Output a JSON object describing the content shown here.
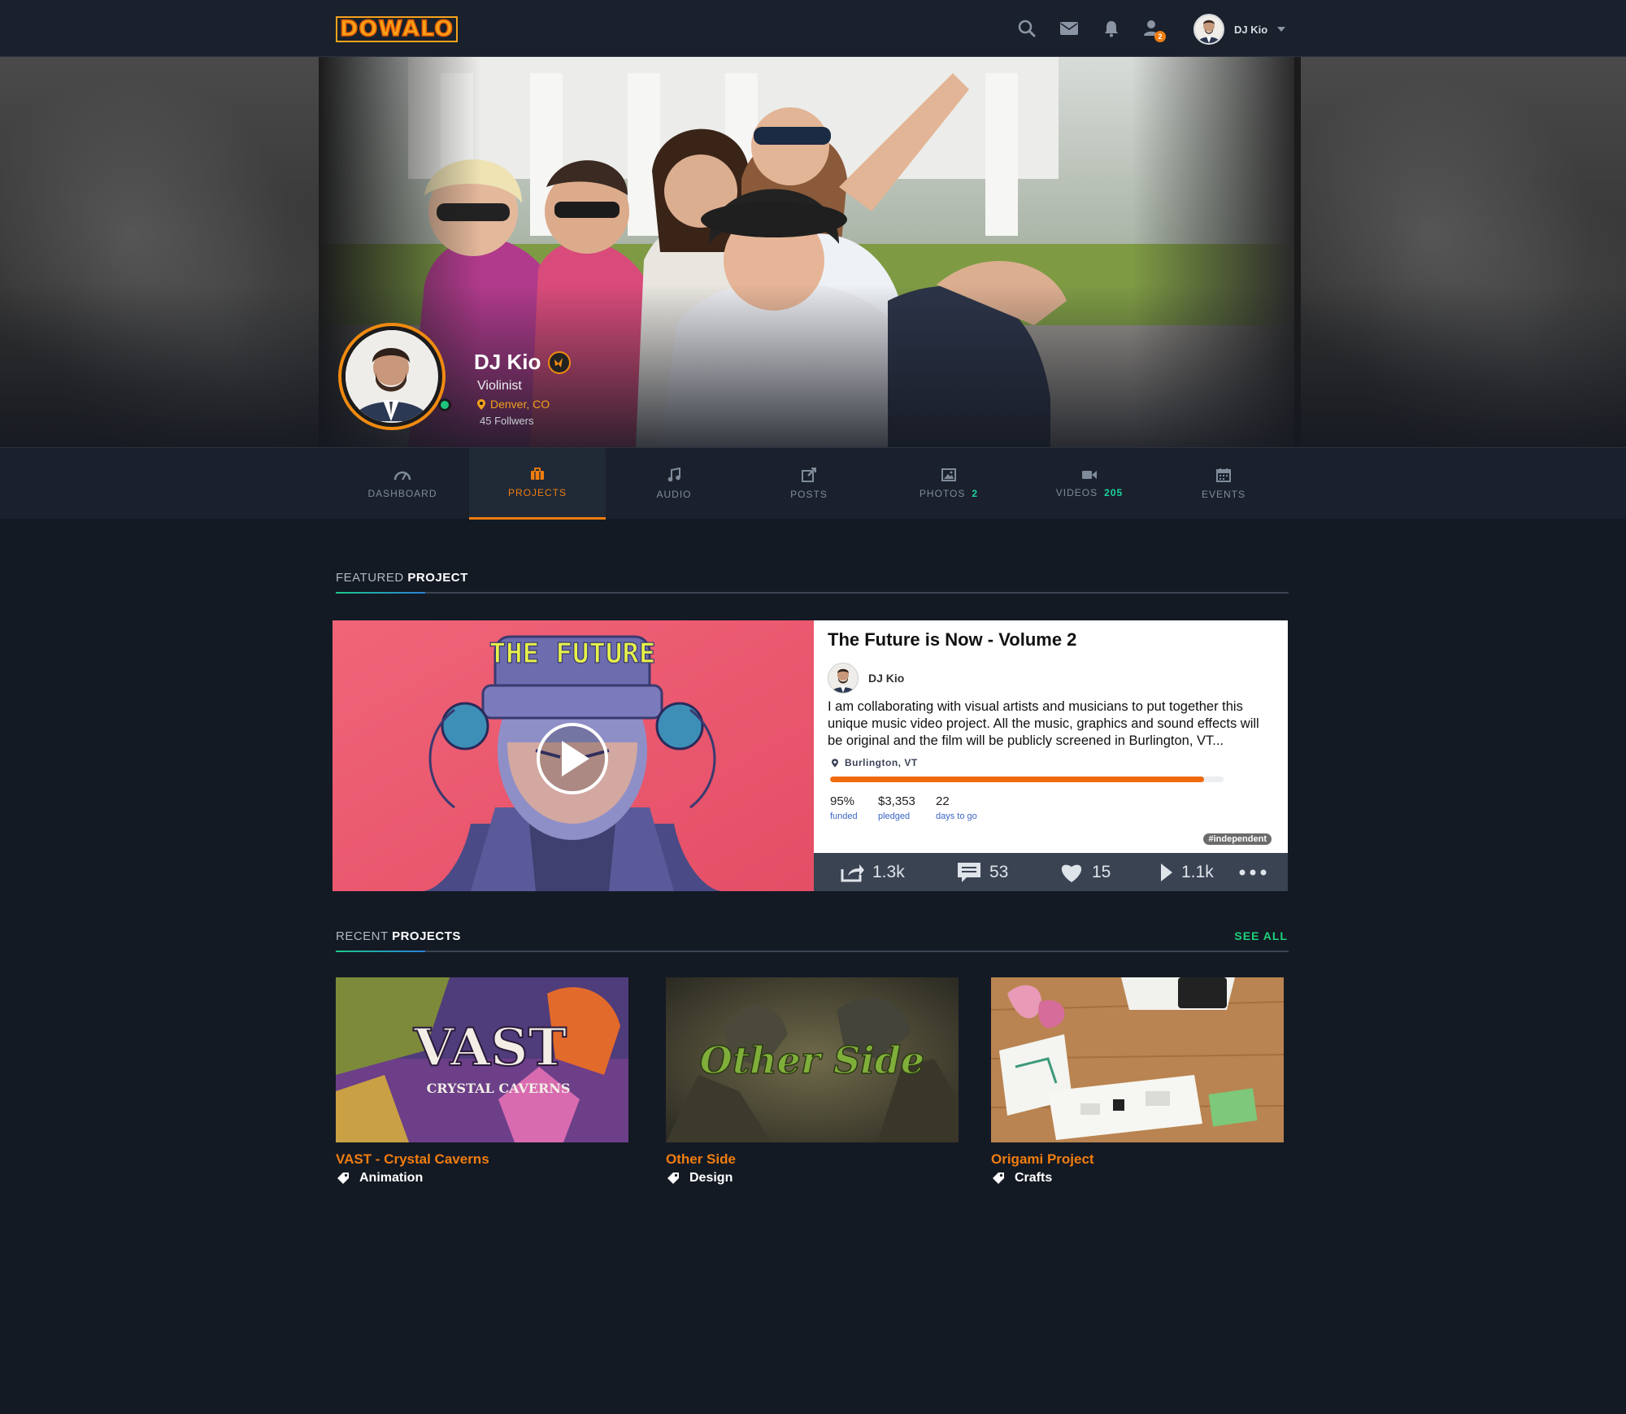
{
  "brand": {
    "logo_text": "DOWALO"
  },
  "topbar": {
    "notifications_badge": "2",
    "user_name": "DJ Kio"
  },
  "profile": {
    "name": "DJ Kio",
    "role": "Violinist",
    "location": "Denver, CO",
    "followers": "45 Follwers"
  },
  "tabs": [
    {
      "label": "DASHBOARD",
      "count": "",
      "icon": "dashboard-icon"
    },
    {
      "label": "PROJECTS",
      "count": "",
      "icon": "briefcase-icon",
      "active": true
    },
    {
      "label": "AUDIO",
      "count": "",
      "icon": "music-note-icon"
    },
    {
      "label": "POSTS",
      "count": "",
      "icon": "edit-post-icon"
    },
    {
      "label": "PHOTOS",
      "count": "2",
      "icon": "image-icon"
    },
    {
      "label": "VIDEOS",
      "count": "205",
      "icon": "video-camera-icon"
    },
    {
      "label": "EVENTS",
      "count": "",
      "icon": "calendar-icon"
    }
  ],
  "featured": {
    "section_prefix": "FEATURED",
    "section_strong": "PROJECT",
    "poster_text": "THE FUTURE",
    "title": "The Future is Now - Volume 2",
    "author": "DJ Kio",
    "description": "I am collaborating with visual artists and musicians to put together this unique music video project. All the music, graphics and sound effects will be original and the film will be publicly screened in  Burlington, VT...",
    "location": "Burlington, VT",
    "funded_value": "95%",
    "funded_label": "funded",
    "funded_fraction": 0.95,
    "pledged_value": "$3,353",
    "pledged_label": "pledged",
    "days_value": "22",
    "days_label": "days to go",
    "tag": "#independent",
    "shares": "1.3k",
    "comments": "53",
    "likes": "15",
    "plays": "1.1k"
  },
  "recent": {
    "section_prefix": "RECENT",
    "section_strong": "PROJECTS",
    "see_all": "SEE ALL",
    "items": [
      {
        "title": "VAST - Crystal Caverns",
        "category": "Animation",
        "thumb_text": "VAST",
        "thumb_sub": "CRYSTAL CAVERNS"
      },
      {
        "title": "Other Side",
        "category": "Design",
        "thumb_text": "Other Side"
      },
      {
        "title": "Origami Project",
        "category": "Crafts"
      }
    ]
  },
  "colors": {
    "accent": "#f07d10",
    "green": "#1fd17b",
    "background": "#141a24"
  }
}
